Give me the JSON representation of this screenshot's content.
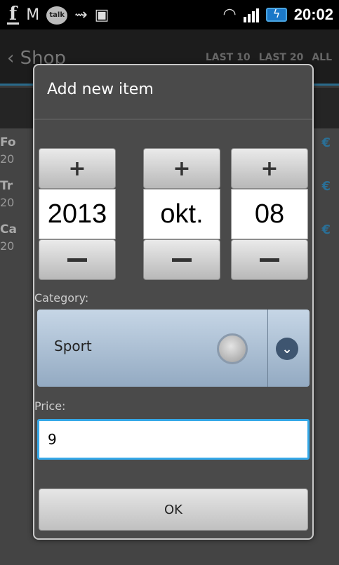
{
  "status_bar": {
    "time": "20:02",
    "icons": [
      "facebook-icon",
      "gmail-icon",
      "talk-icon",
      "usb-icon",
      "android-icon",
      "wifi-icon",
      "signal-icon",
      "battery-icon"
    ],
    "talk_label": "talk"
  },
  "background_app": {
    "back_label": "‹ Shop",
    "tabs": [
      "LAST 10",
      "LAST 20",
      "ALL"
    ],
    "rows": [
      {
        "title": "Fo",
        "date": "20",
        "price": "€"
      },
      {
        "title": "Tr",
        "date": "20",
        "price": "€"
      },
      {
        "title": "Ca",
        "date": "20",
        "price": "€"
      }
    ]
  },
  "dialog": {
    "title": "Add new item",
    "date_picker": {
      "year": "2013",
      "month": "okt.",
      "day": "08",
      "plus_label": "+",
      "minus_label": "−"
    },
    "category_label": "Category:",
    "category_value": "Sport",
    "price_label": "Price:",
    "price_value": "9",
    "ok_label": "OK"
  },
  "colors": {
    "accent": "#35a8e8",
    "dialog_bg": "#4a4a4a",
    "spinner_top": "#c6d6e6"
  }
}
